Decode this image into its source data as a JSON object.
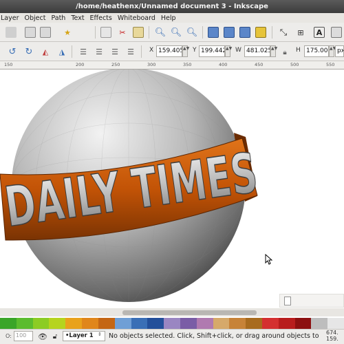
{
  "window": {
    "title": "/home/heathenx/Unnamed document 3 - Inkscape"
  },
  "menubar": {
    "items": [
      "Layer",
      "Object",
      "Path",
      "Text",
      "Effects",
      "Whiteboard",
      "Help"
    ]
  },
  "toolbar_icons": [
    "document-properties-icon",
    "import-icon",
    "export-icon",
    "paste-icon",
    "copy-icon",
    "cut-icon",
    "clipboard-icon",
    "zoom-in-icon",
    "zoom-out-icon",
    "zoom-fit-icon",
    "group-icon",
    "ungroup-icon",
    "duplicate-icon",
    "clone-icon",
    "transform-icon",
    "align-icon",
    "text-font-icon",
    "xml-editor-icon"
  ],
  "transform": {
    "x_label": "X",
    "x_value": "159.405",
    "y_label": "Y",
    "y_value": "199.442",
    "w_label": "W",
    "w_value": "481.025",
    "h_label": "H",
    "h_value": "175.000",
    "unit": "px"
  },
  "ruler": {
    "labels": [
      "150",
      "",
      "200",
      "250",
      "300",
      "350",
      "400",
      "450",
      "500",
      "550"
    ]
  },
  "canvas": {
    "banner_text": "DAILY TIMES",
    "colors": {
      "sphere_light": "#eeeeee",
      "sphere_dark": "#3a3a3a",
      "banner": "#c85a08",
      "banner_dark": "#7a3303"
    }
  },
  "palette": {
    "swatches": [
      "#3aa528",
      "#5bbc2e",
      "#8ccc24",
      "#b6d41e",
      "#e9a21c",
      "#e0861b",
      "#c46614",
      "#6f9fd6",
      "#3a6fb6",
      "#234f9a",
      "#9a86c2",
      "#7a5da6",
      "#b07ab0",
      "#d6a96a",
      "#c78338",
      "#a86b1e",
      "#d43030",
      "#b81d1d",
      "#8c1010",
      "#bdbdbd",
      "#e6e6e6"
    ]
  },
  "statusbar": {
    "opacity_value": "100",
    "layer": "•Layer 1",
    "message": "No objects selected. Click, Shift+click, or drag around objects to",
    "coord_x": "674.",
    "coord_y": "159."
  }
}
